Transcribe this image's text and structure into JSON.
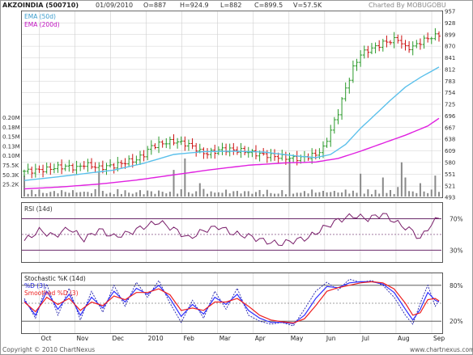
{
  "header": {
    "ticker": "AKZOINDIA (500710)",
    "date": "01/09/2010",
    "open": "O=887",
    "high": "H=924.9",
    "low": "L=882",
    "close": "C=899.5",
    "volume": "V=57.5K",
    "brand": "Charted By MOBUGOBU"
  },
  "footer": {
    "copyright": "Copyright © 2010 ChartNexus",
    "site": "www.chartnexus.com"
  },
  "colors": {
    "ema50": "#5bc0eb",
    "ema200": "#e020e0",
    "bar_up": "#2a9a2a",
    "bar_down": "#cc1111",
    "volume": "#8a8a8a",
    "rsi": "#7a1f6b",
    "band": "#6a2a6a",
    "stoch_k": "#2020aa",
    "stoch_d": "#3030ff",
    "stoch_smooth": "#ee2020",
    "grid": "#cfcfcf"
  },
  "chart_data": [
    {
      "type": "candlestick",
      "title": "AKZOINDIA (500710)",
      "y_ticks": [
        493,
        521,
        551,
        580,
        609,
        638,
        667,
        696,
        725,
        754,
        783,
        812,
        841,
        870,
        899,
        928,
        957
      ],
      "x_ticks": [
        "Oct",
        "Nov",
        "Dec",
        "2010",
        "Feb",
        "Mar",
        "Apr",
        "May",
        "Jun",
        "Jul",
        "Aug",
        "Sep"
      ],
      "ylim": [
        493,
        957
      ],
      "legend": [
        {
          "name": "EMA (50d)",
          "color": "#5bc0eb"
        },
        {
          "name": "EMA (200d)",
          "color": "#e020e0"
        }
      ],
      "price_path": [
        [
          0,
          558
        ],
        [
          3,
          560
        ],
        [
          6,
          563
        ],
        [
          8,
          567
        ],
        [
          11,
          570
        ],
        [
          14,
          566
        ],
        [
          16,
          575
        ],
        [
          18,
          572
        ],
        [
          20,
          566
        ],
        [
          22,
          570
        ],
        [
          24,
          572
        ],
        [
          26,
          578
        ],
        [
          28,
          583
        ],
        [
          30,
          587
        ],
        [
          32,
          600
        ],
        [
          34,
          620
        ],
        [
          37,
          628
        ],
        [
          40,
          633
        ],
        [
          43,
          627
        ],
        [
          45,
          620
        ],
        [
          47,
          607
        ],
        [
          49,
          602
        ],
        [
          51,
          608
        ],
        [
          53,
          613
        ],
        [
          56,
          611
        ],
        [
          59,
          608
        ],
        [
          62,
          602
        ],
        [
          64,
          599
        ],
        [
          66,
          597
        ],
        [
          68,
          594
        ],
        [
          70,
          592
        ],
        [
          72,
          590
        ],
        [
          74,
          591
        ],
        [
          76,
          595
        ],
        [
          78,
          600
        ],
        [
          80,
          615
        ],
        [
          82,
          660
        ],
        [
          84,
          705
        ],
        [
          86,
          765
        ],
        [
          88,
          815
        ],
        [
          90,
          850
        ],
        [
          92,
          860
        ],
        [
          94,
          868
        ],
        [
          96,
          878
        ],
        [
          98,
          883
        ],
        [
          100,
          888
        ],
        [
          102,
          866
        ],
        [
          104,
          868
        ],
        [
          106,
          880
        ],
        [
          108,
          890
        ],
        [
          110,
          895
        ],
        [
          111,
          899.5
        ]
      ],
      "ema50": [
        [
          0,
          535
        ],
        [
          8,
          543
        ],
        [
          16,
          552
        ],
        [
          24,
          561
        ],
        [
          32,
          578
        ],
        [
          40,
          600
        ],
        [
          48,
          607
        ],
        [
          56,
          608
        ],
        [
          64,
          606
        ],
        [
          72,
          597
        ],
        [
          78,
          592
        ],
        [
          82,
          600
        ],
        [
          86,
          625
        ],
        [
          90,
          665
        ],
        [
          94,
          700
        ],
        [
          98,
          735
        ],
        [
          102,
          768
        ],
        [
          106,
          792
        ],
        [
          111,
          818
        ]
      ],
      "ema200": [
        [
          0,
          514
        ],
        [
          10,
          519
        ],
        [
          20,
          526
        ],
        [
          30,
          536
        ],
        [
          40,
          549
        ],
        [
          50,
          562
        ],
        [
          60,
          573
        ],
        [
          70,
          579
        ],
        [
          78,
          581
        ],
        [
          84,
          590
        ],
        [
          90,
          608
        ],
        [
          96,
          628
        ],
        [
          102,
          648
        ],
        [
          108,
          671
        ],
        [
          111,
          690
        ]
      ],
      "volume_spikes": [
        [
          0,
          0.55
        ],
        [
          20,
          0.65
        ],
        [
          40,
          0.7
        ],
        [
          43,
          1.0
        ],
        [
          47,
          0.35
        ],
        [
          71,
          1.0
        ],
        [
          90,
          0.6
        ],
        [
          96,
          0.5
        ],
        [
          100,
          0.25
        ],
        [
          101,
          0.9
        ],
        [
          102,
          0.5
        ],
        [
          106,
          0.35
        ],
        [
          110,
          0.55
        ]
      ]
    },
    {
      "type": "volume",
      "y_ticks": [
        "0.20M",
        "0.18M",
        "0.15M",
        "0.13M",
        "0.10M",
        "75.5K",
        "50.3K",
        "25.2K"
      ],
      "ylim": [
        0,
        0.2
      ]
    },
    {
      "type": "line",
      "title": "RSI (14d)",
      "y_ticks": [
        "70%",
        "30%"
      ],
      "ylim": [
        15,
        90
      ],
      "bands": [
        30,
        50,
        70
      ],
      "series": [
        {
          "name": "RSI (14d)",
          "points": [
            [
              0,
              42
            ],
            [
              4,
              55
            ],
            [
              8,
              48
            ],
            [
              12,
              58
            ],
            [
              16,
              44
            ],
            [
              20,
              56
            ],
            [
              24,
              47
            ],
            [
              28,
              52
            ],
            [
              32,
              60
            ],
            [
              36,
              66
            ],
            [
              40,
              57
            ],
            [
              44,
              45
            ],
            [
              48,
              55
            ],
            [
              52,
              60
            ],
            [
              56,
              51
            ],
            [
              60,
              48
            ],
            [
              64,
              42
            ],
            [
              68,
              38
            ],
            [
              72,
              42
            ],
            [
              76,
              46
            ],
            [
              80,
              58
            ],
            [
              84,
              68
            ],
            [
              88,
              74
            ],
            [
              92,
              70
            ],
            [
              96,
              76
            ],
            [
              100,
              64
            ],
            [
              104,
              54
            ],
            [
              106,
              44
            ],
            [
              108,
              58
            ],
            [
              111,
              72
            ]
          ]
        }
      ]
    },
    {
      "type": "line",
      "title": "Stochastic %K (14d)",
      "y_ticks": [
        "80%",
        "20%"
      ],
      "ylim": [
        0,
        100
      ],
      "bands": [
        20,
        50,
        80
      ],
      "series": [
        {
          "name": "%K",
          "points": [
            [
              0,
              58
            ],
            [
              3,
              25
            ],
            [
              6,
              82
            ],
            [
              9,
              30
            ],
            [
              12,
              75
            ],
            [
              15,
              22
            ],
            [
              18,
              70
            ],
            [
              21,
              35
            ],
            [
              24,
              80
            ],
            [
              27,
              45
            ],
            [
              30,
              85
            ],
            [
              33,
              60
            ],
            [
              36,
              88
            ],
            [
              39,
              50
            ],
            [
              42,
              18
            ],
            [
              45,
              55
            ],
            [
              48,
              25
            ],
            [
              51,
              70
            ],
            [
              54,
              40
            ],
            [
              57,
              75
            ],
            [
              60,
              30
            ],
            [
              63,
              20
            ],
            [
              66,
              15
            ],
            [
              69,
              18
            ],
            [
              72,
              12
            ],
            [
              75,
              40
            ],
            [
              78,
              70
            ],
            [
              81,
              85
            ],
            [
              84,
              72
            ],
            [
              87,
              90
            ],
            [
              90,
              85
            ],
            [
              93,
              88
            ],
            [
              96,
              80
            ],
            [
              99,
              60
            ],
            [
              102,
              30
            ],
            [
              104,
              15
            ],
            [
              106,
              50
            ],
            [
              108,
              80
            ],
            [
              110,
              45
            ],
            [
              111,
              55
            ]
          ]
        },
        {
          "name": "%D (3)",
          "points": [
            [
              0,
              55
            ],
            [
              3,
              30
            ],
            [
              6,
              70
            ],
            [
              9,
              40
            ],
            [
              12,
              65
            ],
            [
              15,
              30
            ],
            [
              18,
              60
            ],
            [
              21,
              42
            ],
            [
              24,
              70
            ],
            [
              27,
              52
            ],
            [
              30,
              75
            ],
            [
              33,
              65
            ],
            [
              36,
              80
            ],
            [
              39,
              58
            ],
            [
              42,
              28
            ],
            [
              45,
              48
            ],
            [
              48,
              32
            ],
            [
              51,
              60
            ],
            [
              54,
              48
            ],
            [
              57,
              65
            ],
            [
              60,
              38
            ],
            [
              63,
              25
            ],
            [
              66,
              18
            ],
            [
              69,
              18
            ],
            [
              72,
              16
            ],
            [
              75,
              30
            ],
            [
              78,
              58
            ],
            [
              81,
              78
            ],
            [
              84,
              76
            ],
            [
              87,
              84
            ],
            [
              90,
              86
            ],
            [
              93,
              86
            ],
            [
              96,
              82
            ],
            [
              99,
              68
            ],
            [
              102,
              40
            ],
            [
              104,
              22
            ],
            [
              106,
              40
            ],
            [
              108,
              68
            ],
            [
              110,
              55
            ],
            [
              111,
              52
            ]
          ]
        },
        {
          "name": "Smoothed %D (3)",
          "points": [
            [
              0,
              52
            ],
            [
              3,
              36
            ],
            [
              6,
              60
            ],
            [
              9,
              48
            ],
            [
              12,
              58
            ],
            [
              15,
              38
            ],
            [
              18,
              52
            ],
            [
              21,
              46
            ],
            [
              24,
              62
            ],
            [
              27,
              56
            ],
            [
              30,
              68
            ],
            [
              33,
              68
            ],
            [
              36,
              74
            ],
            [
              39,
              64
            ],
            [
              42,
              38
            ],
            [
              45,
              42
            ],
            [
              48,
              38
            ],
            [
              51,
              52
            ],
            [
              54,
              52
            ],
            [
              57,
              58
            ],
            [
              60,
              45
            ],
            [
              63,
              30
            ],
            [
              66,
              22
            ],
            [
              69,
              19
            ],
            [
              72,
              17
            ],
            [
              75,
              24
            ],
            [
              78,
              46
            ],
            [
              81,
              70
            ],
            [
              84,
              76
            ],
            [
              87,
              80
            ],
            [
              90,
              84
            ],
            [
              93,
              86
            ],
            [
              96,
              84
            ],
            [
              99,
              74
            ],
            [
              102,
              50
            ],
            [
              104,
              30
            ],
            [
              106,
              34
            ],
            [
              108,
              56
            ],
            [
              110,
              58
            ],
            [
              111,
              54
            ]
          ]
        }
      ]
    }
  ]
}
